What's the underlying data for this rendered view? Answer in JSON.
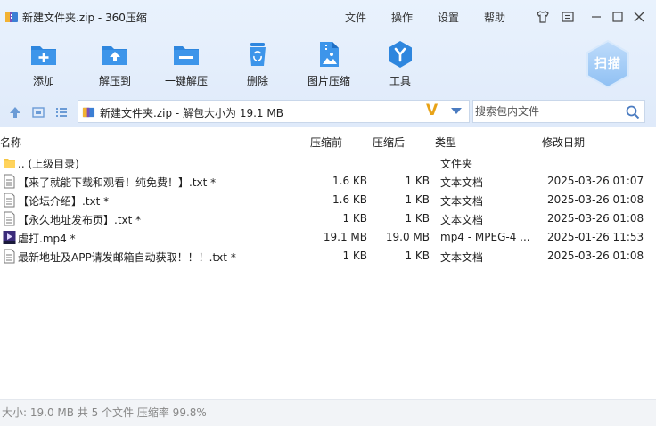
{
  "window": {
    "title": "新建文件夹.zip - 360压缩",
    "menu": [
      "文件",
      "操作",
      "设置",
      "帮助"
    ]
  },
  "toolbar": {
    "tools": [
      {
        "label": "添加",
        "icon": "add-icon"
      },
      {
        "label": "解压到",
        "icon": "extract-to-icon"
      },
      {
        "label": "一键解压",
        "icon": "one-click-extract-icon"
      },
      {
        "label": "删除",
        "icon": "trash-icon"
      },
      {
        "label": "图片压缩",
        "icon": "image-compress-icon"
      },
      {
        "label": "工具",
        "icon": "tools-icon"
      }
    ],
    "scan_label": "扫描"
  },
  "address": {
    "text": "新建文件夹.zip - 解包大小为 19.1 MB",
    "badge": "V"
  },
  "search": {
    "placeholder": "搜索包内文件"
  },
  "table": {
    "headers": [
      "名称",
      "压缩前",
      "压缩后",
      "类型",
      "修改日期"
    ],
    "rows": [
      {
        "name": ".. (上级目录)",
        "size": "",
        "compressed": "",
        "type": "文件夹",
        "date": "",
        "icon": "folder-icon"
      },
      {
        "name": "【来了就能下载和观看！纯免费！】.txt *",
        "size": "1.6 KB",
        "compressed": "1 KB",
        "type": "文本文档",
        "date": "2025-03-26 01:07",
        "icon": "text-file-icon"
      },
      {
        "name": "【论坛介绍】.txt *",
        "size": "1.6 KB",
        "compressed": "1 KB",
        "type": "文本文档",
        "date": "2025-03-26 01:08",
        "icon": "text-file-icon"
      },
      {
        "name": "【永久地址发布页】.txt *",
        "size": "1 KB",
        "compressed": "1 KB",
        "type": "文本文档",
        "date": "2025-03-26 01:08",
        "icon": "text-file-icon"
      },
      {
        "name": "虐打.mp4 *",
        "size": "19.1 MB",
        "compressed": "19.0 MB",
        "type": "mp4 - MPEG-4 ...",
        "date": "2025-01-26 11:53",
        "icon": "video-file-icon"
      },
      {
        "name": "最新地址及APP请发邮箱自动获取！！！.txt *",
        "size": "1 KB",
        "compressed": "1 KB",
        "type": "文本文档",
        "date": "2025-03-26 01:08",
        "icon": "text-file-icon"
      }
    ]
  },
  "status": {
    "text": "大小: 19.0 MB 共 5 个文件 压缩率 99.8%"
  },
  "colors": {
    "accent": "#2e86de",
    "toolbar_bg": "#e6f0fc",
    "badge": "#e8a318"
  }
}
